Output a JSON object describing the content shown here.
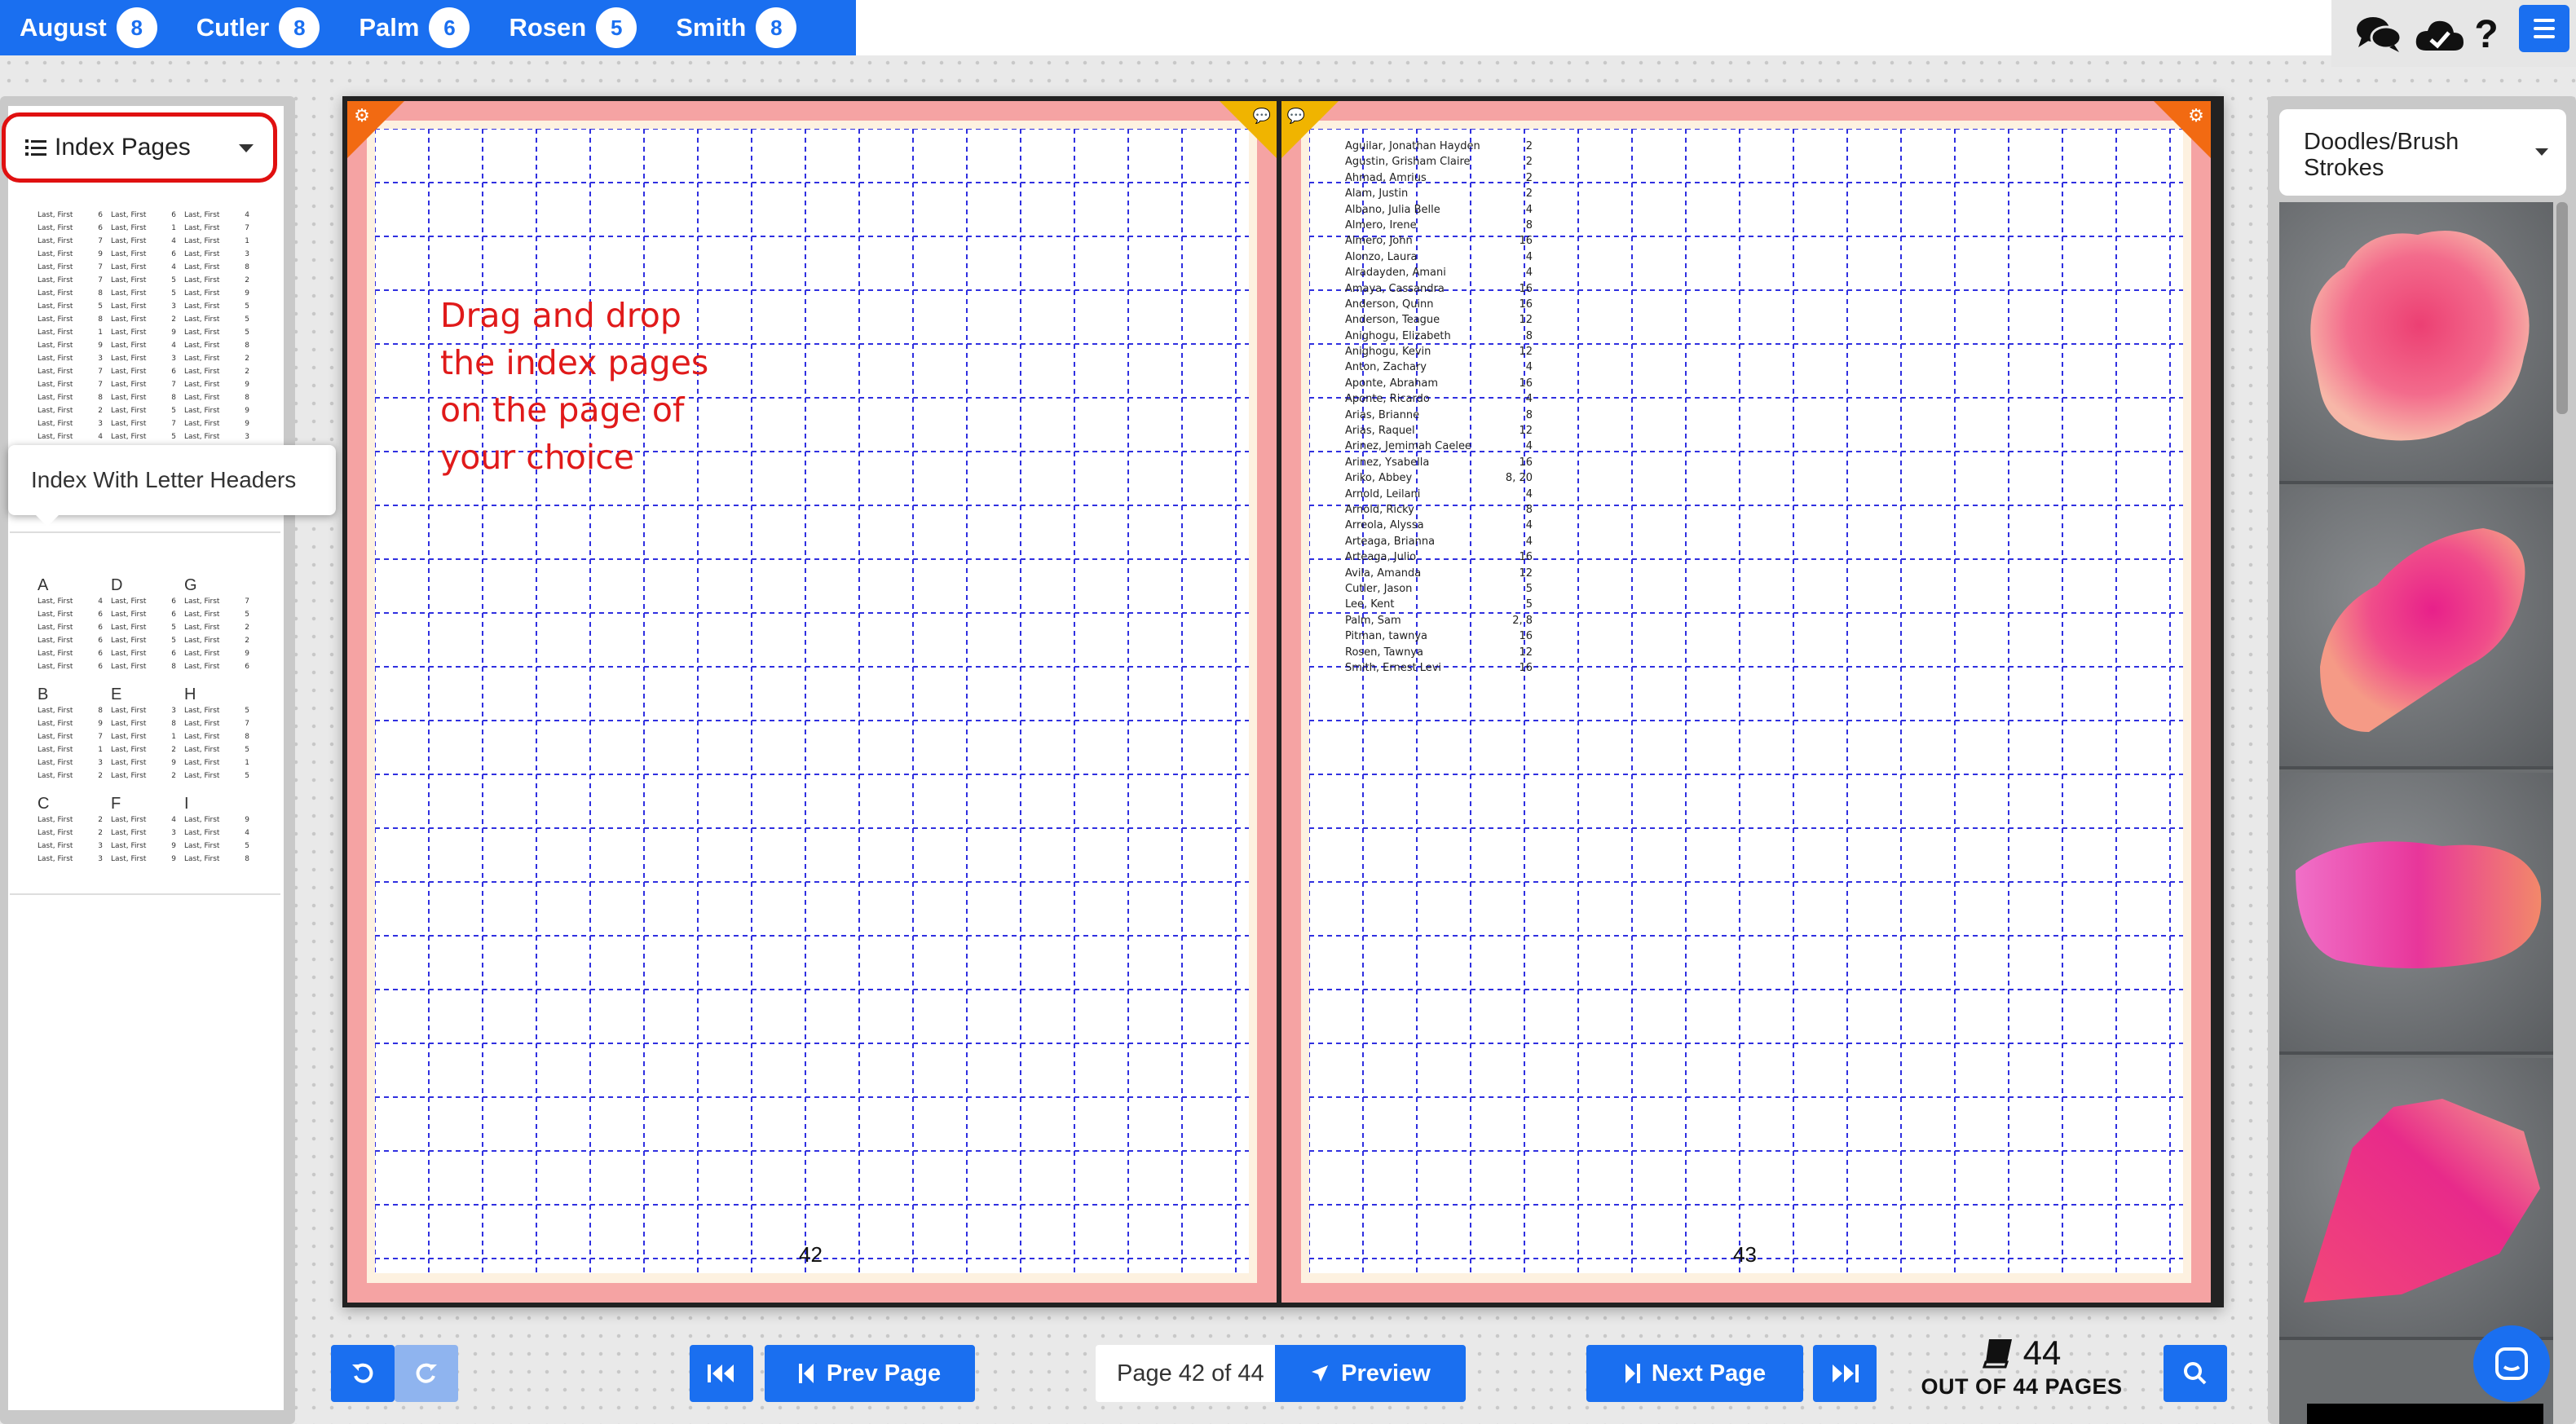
{
  "users": [
    {
      "name": "August",
      "count": "8"
    },
    {
      "name": "Cutler",
      "count": "8"
    },
    {
      "name": "Palm",
      "count": "6"
    },
    {
      "name": "Rosen",
      "count": "5"
    },
    {
      "name": "Smith",
      "count": "8"
    }
  ],
  "left_panel": {
    "select_label": "Index Pages",
    "tooltip": "Index With Letter Headers",
    "thumb1_entry": "Last, First",
    "thumb1_nums": [
      [
        "6",
        "6",
        "4"
      ],
      [
        "6",
        "1",
        "7"
      ],
      [
        "7",
        "4",
        "1"
      ],
      [
        "9",
        "6",
        "3"
      ],
      [
        "7",
        "4",
        "8"
      ],
      [
        "7",
        "5",
        "2"
      ],
      [
        "8",
        "5",
        "9"
      ],
      [
        "5",
        "3",
        "5"
      ],
      [
        "8",
        "2",
        "5"
      ],
      [
        "1",
        "9",
        "5"
      ],
      [
        "9",
        "4",
        "8"
      ],
      [
        "3",
        "3",
        "2"
      ],
      [
        "7",
        "6",
        "2"
      ],
      [
        "7",
        "7",
        "9"
      ],
      [
        "8",
        "8",
        "8"
      ],
      [
        "2",
        "5",
        "9"
      ],
      [
        "3",
        "7",
        "9"
      ],
      [
        "4",
        "5",
        "3"
      ]
    ],
    "thumb2_groups": [
      {
        "letters": [
          "A",
          "D",
          "G"
        ],
        "nums": [
          [
            "4",
            "6",
            "7"
          ],
          [
            "6",
            "6",
            "5"
          ],
          [
            "6",
            "5",
            "2"
          ],
          [
            "6",
            "5",
            "2"
          ],
          [
            "6",
            "6",
            "9"
          ],
          [
            "6",
            "8",
            "6"
          ]
        ]
      },
      {
        "letters": [
          "B",
          "E",
          "H"
        ],
        "nums": [
          [
            "8",
            "3",
            "5"
          ],
          [
            "9",
            "8",
            "7"
          ],
          [
            "7",
            "1",
            "8"
          ],
          [
            "1",
            "2",
            "5"
          ],
          [
            "3",
            "9",
            "1"
          ],
          [
            "2",
            "2",
            "5"
          ]
        ]
      },
      {
        "letters": [
          "C",
          "F",
          "I"
        ],
        "nums": [
          [
            "2",
            "4",
            "9"
          ],
          [
            "2",
            "3",
            "4"
          ],
          [
            "3",
            "9",
            "5"
          ],
          [
            "3",
            "9",
            "8"
          ]
        ]
      }
    ]
  },
  "book": {
    "left_page_number": "42",
    "right_page_number": "43",
    "instruction_lines": [
      "Drag and drop",
      "the index pages",
      "on the page of",
      "your choice"
    ],
    "index_entries": [
      {
        "name": "Aguilar, Jonathan Hayden",
        "page": "2"
      },
      {
        "name": "Agustin, Grisham Claire",
        "page": "2"
      },
      {
        "name": "Ahmad, Amrius",
        "page": "2"
      },
      {
        "name": "Alam, Justin",
        "page": "2"
      },
      {
        "name": "Albano, Julia Belle",
        "page": "4"
      },
      {
        "name": "Almero, Irene",
        "page": "8"
      },
      {
        "name": "Almero, John",
        "page": "16"
      },
      {
        "name": "Alonzo, Laura",
        "page": "4"
      },
      {
        "name": "Alradayden, Amani",
        "page": "4"
      },
      {
        "name": "Amaya, Cassandra",
        "page": "16"
      },
      {
        "name": "Anderson, Quinn",
        "page": "16"
      },
      {
        "name": "Anderson, Teague",
        "page": "12"
      },
      {
        "name": "Anighogu, Elizabeth",
        "page": "8"
      },
      {
        "name": "Anighogu, Kevin",
        "page": "12"
      },
      {
        "name": "Anton, Zachary",
        "page": "4"
      },
      {
        "name": "Aponte, Abraham",
        "page": "16"
      },
      {
        "name": "Aponte, Ricardo",
        "page": "4"
      },
      {
        "name": "Arias, Brianne",
        "page": "8"
      },
      {
        "name": "Arias, Raquel",
        "page": "12"
      },
      {
        "name": "Arinez, Jemimah Caelee",
        "page": "4"
      },
      {
        "name": "Arinez, Ysabella",
        "page": "16"
      },
      {
        "name": "Ariko, Abbey",
        "page": "8, 20"
      },
      {
        "name": "Arnold, Leilani",
        "page": "4"
      },
      {
        "name": "Arnold, Ricky",
        "page": "8"
      },
      {
        "name": "Arreola, Alyssa",
        "page": "4"
      },
      {
        "name": "Arteaga, Brianna",
        "page": "4"
      },
      {
        "name": "Arteaga, Julio",
        "page": "16"
      },
      {
        "name": "Avila, Amanda",
        "page": "12"
      },
      {
        "name": "Cutler, Jason",
        "page": "5"
      },
      {
        "name": "Lee, Kent",
        "page": "5"
      },
      {
        "name": "Palm, Sam",
        "page": "2, 8"
      },
      {
        "name": "Pitman, tawnya",
        "page": "16"
      },
      {
        "name": "Rosen, Tawnya",
        "page": "12"
      },
      {
        "name": "Smith, Ernest Levi",
        "page": "16"
      }
    ]
  },
  "right_panel": {
    "select_label": "Doodles/Brush Strokes"
  },
  "bottom_bar": {
    "prev_page": "Prev Page",
    "page_input": "Page 42 of 44",
    "preview": "Preview",
    "next_page": "Next Page",
    "page_count": "44",
    "out_of": "OUT OF 44 PAGES"
  },
  "icons": {
    "chat": "chat-icon",
    "cloud": "cloud-check-icon",
    "help": "help-icon",
    "menu": "hamburger-icon"
  },
  "colors": {
    "accent": "#1a6ff0",
    "page_border": "#f5a3a3",
    "grid": "#3030e0",
    "instruction": "#e01a1a",
    "corner_orange": "#f26a12",
    "corner_yellow": "#f0b400"
  }
}
